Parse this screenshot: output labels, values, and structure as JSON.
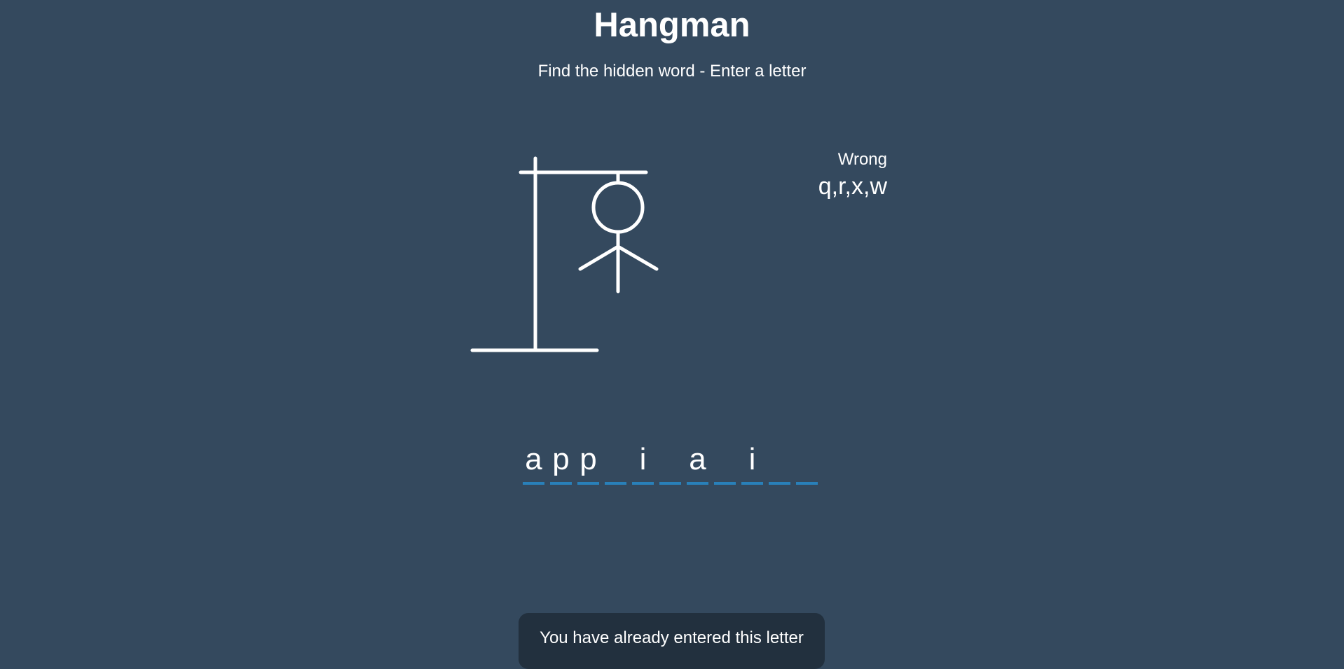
{
  "game": {
    "title": "Hangman",
    "subtitle": "Find the hidden word - Enter a letter"
  },
  "wrong": {
    "label": "Wrong",
    "letters": "q,r,x,w"
  },
  "word": {
    "slots": [
      "a",
      "p",
      "p",
      "",
      "i",
      "",
      "a",
      "",
      "i",
      "",
      ""
    ]
  },
  "hangman": {
    "wrong_guesses": 4,
    "visible_parts": [
      "head",
      "body",
      "left-arm",
      "right-arm"
    ]
  },
  "notification": {
    "message": "You have already entered this letter"
  },
  "colors": {
    "background": "#34495e",
    "text": "#ffffff",
    "underline": "#2980b9",
    "notification_background": "#22303e"
  }
}
